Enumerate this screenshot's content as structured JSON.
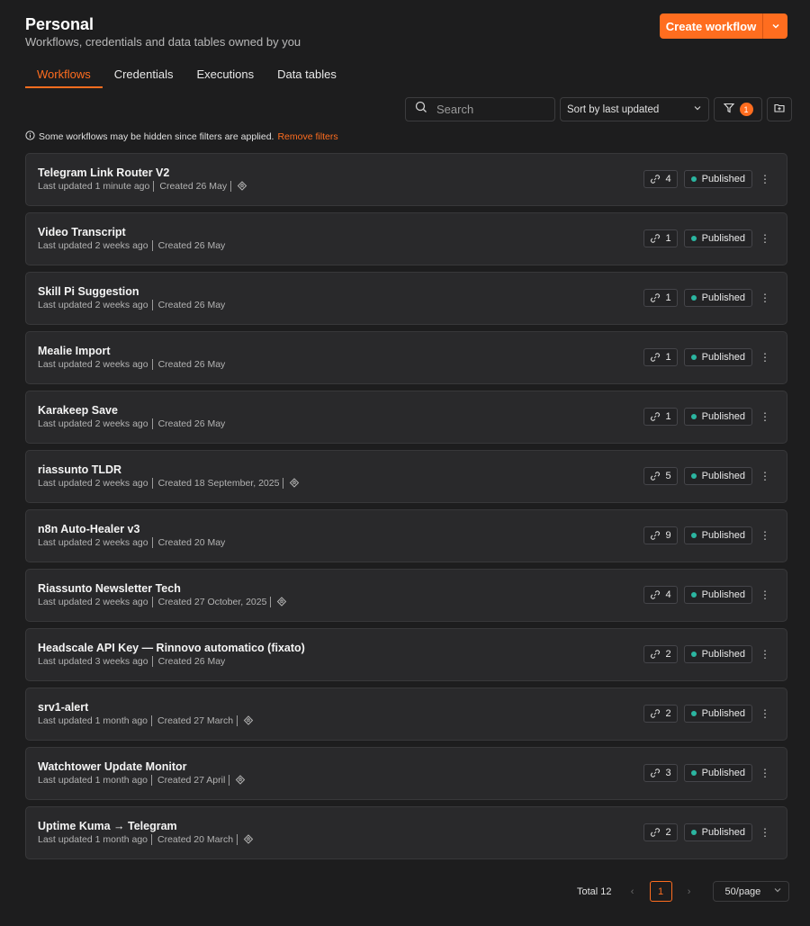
{
  "header": {
    "title": "Personal",
    "subtitle": "Workflows, credentials and data tables owned by you",
    "create_label": "Create workflow"
  },
  "tabs": [
    {
      "label": "Workflows",
      "active": true
    },
    {
      "label": "Credentials"
    },
    {
      "label": "Executions"
    },
    {
      "label": "Data tables"
    }
  ],
  "toolbar": {
    "search_placeholder": "Search",
    "sort_value": "Sort by last updated",
    "filter_count": "1"
  },
  "notice": {
    "text": "Some workflows may be hidden since filters are applied.",
    "link": "Remove filters"
  },
  "workflows": [
    {
      "name": "Telegram Link Router V2",
      "updated": "Last updated 1 minute ago",
      "created": "Created 26 May",
      "archive_icon": true,
      "links": "4",
      "status": "Published"
    },
    {
      "name": "Video Transcript",
      "updated": "Last updated 2 weeks ago",
      "created": "Created 26 May",
      "archive_icon": false,
      "links": "1",
      "status": "Published"
    },
    {
      "name": "Skill Pi Suggestion",
      "updated": "Last updated 2 weeks ago",
      "created": "Created 26 May",
      "archive_icon": false,
      "links": "1",
      "status": "Published"
    },
    {
      "name": "Mealie Import",
      "updated": "Last updated 2 weeks ago",
      "created": "Created 26 May",
      "archive_icon": false,
      "links": "1",
      "status": "Published"
    },
    {
      "name": "Karakeep Save",
      "updated": "Last updated 2 weeks ago",
      "created": "Created 26 May",
      "archive_icon": false,
      "links": "1",
      "status": "Published"
    },
    {
      "name": "riassunto TLDR",
      "updated": "Last updated 2 weeks ago",
      "created": "Created 18 September, 2025",
      "archive_icon": true,
      "links": "5",
      "status": "Published"
    },
    {
      "name": "n8n Auto-Healer v3",
      "updated": "Last updated 2 weeks ago",
      "created": "Created 20 May",
      "archive_icon": false,
      "links": "9",
      "status": "Published"
    },
    {
      "name": "Riassunto Newsletter Tech",
      "updated": "Last updated 2 weeks ago",
      "created": "Created 27 October, 2025",
      "archive_icon": true,
      "links": "4",
      "status": "Published"
    },
    {
      "name": "Headscale API Key — Rinnovo automatico (fixato)",
      "updated": "Last updated 3 weeks ago",
      "created": "Created 26 May",
      "archive_icon": false,
      "links": "2",
      "status": "Published"
    },
    {
      "name": "srv1-alert",
      "updated": "Last updated 1 month ago",
      "created": "Created 27 March",
      "archive_icon": true,
      "links": "2",
      "status": "Published"
    },
    {
      "name": "Watchtower Update Monitor",
      "updated": "Last updated 1 month ago",
      "created": "Created 27 April",
      "archive_icon": true,
      "links": "3",
      "status": "Published"
    },
    {
      "name": "Uptime Kuma → Telegram",
      "updated": "Last updated 1 month ago",
      "created": "Created 20 March",
      "archive_icon": true,
      "links": "2",
      "status": "Published"
    }
  ],
  "pagination": {
    "total": "Total 12",
    "page": "1",
    "per_page": "50/page"
  },
  "colors": {
    "accent": "#ff6d1f",
    "published_dot": "#2bb5a0",
    "background": "#1d1d1e",
    "card": "#29292b"
  }
}
